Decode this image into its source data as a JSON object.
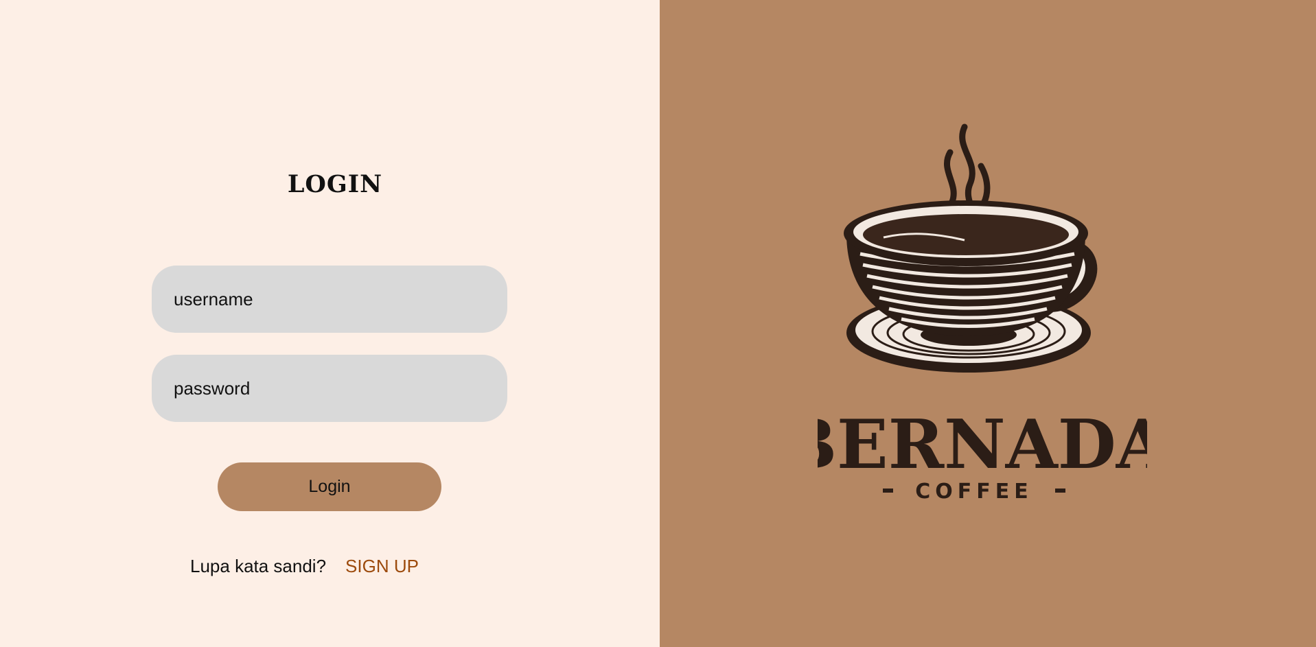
{
  "login_panel": {
    "title": "LOGIN",
    "username_placeholder": "username",
    "password_placeholder": "password",
    "login_button_label": "Login",
    "forgot_password_label": "Lupa kata sandi?",
    "signup_label": "SIGN UP"
  },
  "brand_panel": {
    "brand_name": "BERNADA",
    "brand_subtitle": "COFFEE",
    "logo_icon": "coffee-cup-icon"
  },
  "colors": {
    "left_background": "#fdefe6",
    "right_background": "#b58763",
    "input_background": "#d9d9d9",
    "button_background": "#b58763",
    "signup_link": "#9c4a0c",
    "logo_ink": "#2b1d16"
  }
}
